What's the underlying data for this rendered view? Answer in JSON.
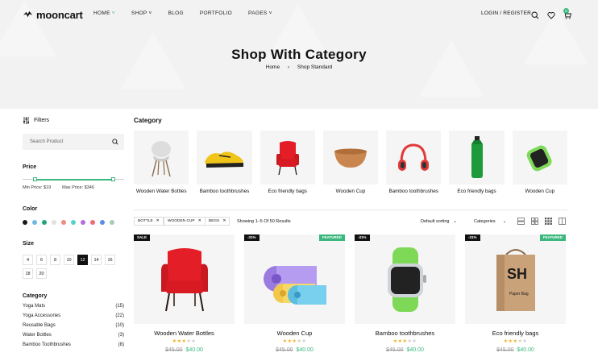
{
  "header": {
    "logo": "mooncart",
    "nav": [
      "HOME",
      "SHOP",
      "BLOG",
      "PORTFOLIO",
      "PAGES"
    ],
    "login": "LOGIN / REGISTER",
    "cart_count": "0",
    "title": "Shop With Category",
    "breadcrumb": [
      "Home",
      "Shop Standard"
    ]
  },
  "sidebar": {
    "filters_label": "Filters",
    "search_placeholder": "Search Product",
    "price_heading": "Price",
    "min_price": "Min Price: $19",
    "max_price": "Max Price: $346",
    "color_heading": "Color",
    "colors": [
      "#1a1a1a",
      "#6fb8e6",
      "#1fa67a",
      "#e2e2e2",
      "#f08a7e",
      "#5ad1c8",
      "#b36fe0",
      "#ef6b7a",
      "#5a8ee6",
      "#a9c9b9"
    ],
    "size_heading": "Size",
    "sizes": [
      "4",
      "6",
      "8",
      "10",
      "12",
      "14",
      "16",
      "18",
      "20"
    ],
    "selected_size": "12",
    "category_heading": "Category",
    "categories": [
      {
        "name": "Yoga Mats",
        "count": "(15)"
      },
      {
        "name": "Yoga Accessories",
        "count": "(22)"
      },
      {
        "name": "Reusable Bags",
        "count": "(10)"
      },
      {
        "name": "Water Bottles",
        "count": "(3)"
      },
      {
        "name": "Bamboo Toothbrushes",
        "count": "(8)"
      }
    ]
  },
  "main": {
    "category_heading": "Category",
    "categories": [
      "Wooden Water Bottles",
      "Bamboo toothbrushes",
      "Eco friendly bags",
      "Wooden Cup",
      "Bamboo toothbrushes",
      "Eco friendly bags",
      "Wooden Cup"
    ],
    "chips": [
      "BOTTLE",
      "WOODEN CUP",
      "BEGS"
    ],
    "results": "Showing 1–5 Of 50 Results",
    "sort": "Default sorting",
    "category_select": "Categories",
    "products": [
      {
        "name": "Wooden Water Bottles",
        "old": "$45.00",
        "new": "$40.00",
        "tag_left": "SALE",
        "tag_right": ""
      },
      {
        "name": "Wooden Cup",
        "old": "$45.00",
        "new": "$40.00",
        "tag_left": "-31%",
        "tag_right": "FEATURED"
      },
      {
        "name": "Bamboo toothbrushes",
        "old": "$45.00",
        "new": "$40.00",
        "tag_left": "-31%",
        "tag_right": ""
      },
      {
        "name": "Eco friendly bags",
        "old": "$45.00",
        "new": "$40.00",
        "tag_left": "-31%",
        "tag_right": "FEATURED"
      }
    ],
    "rating": 3
  }
}
